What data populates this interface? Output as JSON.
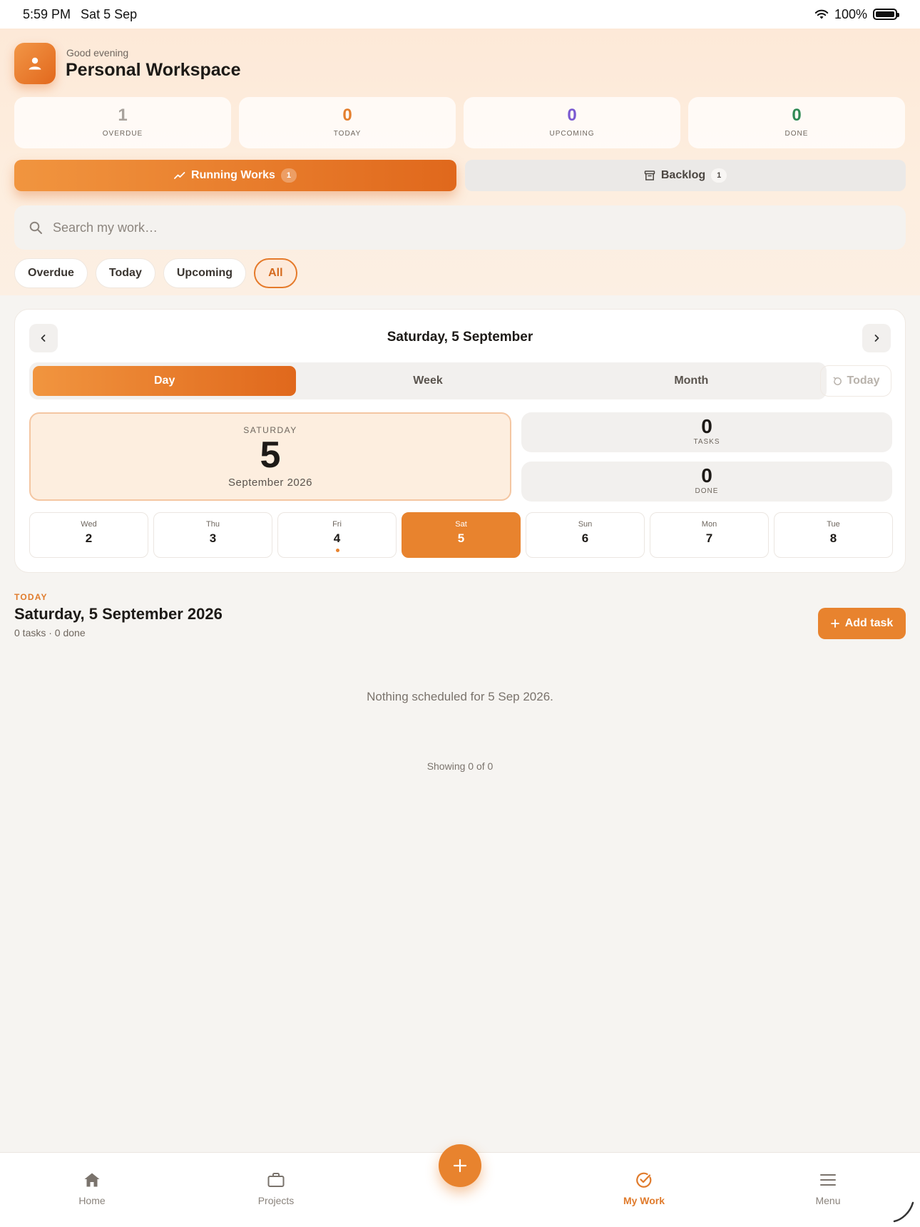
{
  "status": {
    "time": "5:59 PM",
    "date": "Sat 5 Sep",
    "battery": "100%"
  },
  "header": {
    "greeting": "Good evening",
    "workspace": "Personal Workspace"
  },
  "stats": [
    {
      "value": "1",
      "label": "OVERDUE",
      "color": "#a8a29c"
    },
    {
      "value": "0",
      "label": "TODAY",
      "color": "#e47f2e"
    },
    {
      "value": "0",
      "label": "UPCOMING",
      "color": "#7b5ad1"
    },
    {
      "value": "0",
      "label": "DONE",
      "color": "#2f8a55"
    }
  ],
  "views": {
    "running": {
      "label": "Running Works",
      "count": "1",
      "icon": "trend-icon"
    },
    "backlog": {
      "label": "Backlog",
      "count": "1",
      "icon": "archive-icon"
    }
  },
  "search": {
    "placeholder": "Search my work…",
    "value": ""
  },
  "filters": {
    "chips": [
      "Overdue",
      "Today",
      "Upcoming",
      "All"
    ],
    "active": "All"
  },
  "calendar": {
    "title": "Saturday, 5 September",
    "modes": [
      "Day",
      "Week",
      "Month"
    ],
    "active_mode": "Day",
    "today_label": "Today",
    "selected": {
      "weekday": "SATURDAY",
      "day": "5",
      "month_year": "September 2026"
    },
    "tasks": {
      "value": "0",
      "label": "TASKS"
    },
    "done": {
      "value": "0",
      "label": "DONE"
    },
    "week": [
      {
        "name": "Wed",
        "day": "2"
      },
      {
        "name": "Thu",
        "day": "3"
      },
      {
        "name": "Fri",
        "day": "4",
        "has_dot": true
      },
      {
        "name": "Sat",
        "day": "5",
        "active": true
      },
      {
        "name": "Sun",
        "day": "6"
      },
      {
        "name": "Mon",
        "day": "7"
      },
      {
        "name": "Tue",
        "day": "8"
      }
    ]
  },
  "section": {
    "tag": "TODAY",
    "title": "Saturday, 5 September 2026",
    "subtitle": "0 tasks · 0 done",
    "add_label": "Add task"
  },
  "empty_text": "Nothing scheduled for 5 Sep 2026.",
  "showing_text": "Showing 0 of 0",
  "tabbar": {
    "items": [
      {
        "label": "Home",
        "icon": "home-icon"
      },
      {
        "label": "Projects",
        "icon": "briefcase-icon"
      },
      {
        "label": "My Work",
        "icon": "check-circle-icon",
        "active": true
      },
      {
        "label": "Menu",
        "icon": "menu-icon"
      }
    ]
  },
  "colors": {
    "accent": "#e8832e",
    "accent_dark": "#e0681c"
  }
}
